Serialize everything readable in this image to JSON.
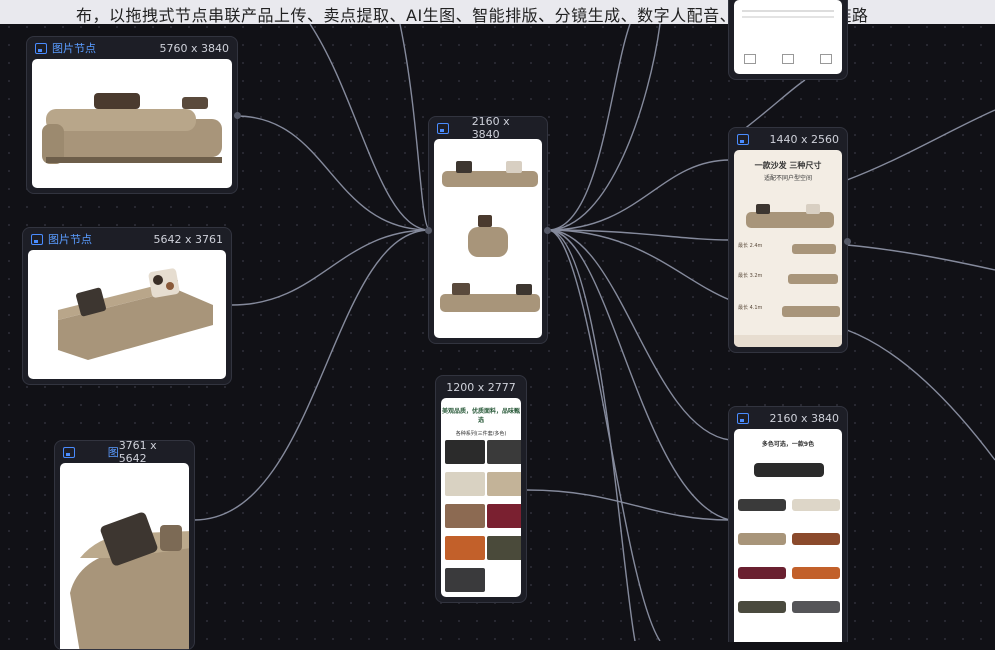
{
  "topbar": {
    "text": "布，以拖拽式节点串联产品上传、卖点提取、AI生图、智能排版、分镜生成、数字人配音、AI自动混剪全链路"
  },
  "nodes": [
    {
      "id": "n1",
      "label": "图片节点",
      "size": "5760 x 3840"
    },
    {
      "id": "n2",
      "label": "图片节点",
      "size": "5642 x 3761"
    },
    {
      "id": "n3",
      "label": "图",
      "size": "3761 x 5642"
    },
    {
      "id": "n4",
      "label": "",
      "size": "2160 x 3840"
    },
    {
      "id": "n5",
      "label": "",
      "size": "1200 x 2777"
    },
    {
      "id": "n6",
      "label": "",
      "size": "1440 x 2560"
    },
    {
      "id": "n7",
      "label": "",
      "size": "2160 x 3840"
    }
  ],
  "poster1440": {
    "title1": "一款沙发 三种尺寸",
    "title2": "适配不同户型空间",
    "rows": [
      "最长 2.4m",
      "最长 3.2m",
      "最长 4.1m"
    ]
  },
  "poster1200": {
    "title": "美观品质，优质面料，品味甄选",
    "sub": "各种系列(三件套/多色)"
  },
  "poster2160b": {
    "title": "多色可选，一款9色"
  },
  "colors": {
    "accent": "#4a8cff",
    "bg": "#111116",
    "sofa": "#a8957a"
  }
}
